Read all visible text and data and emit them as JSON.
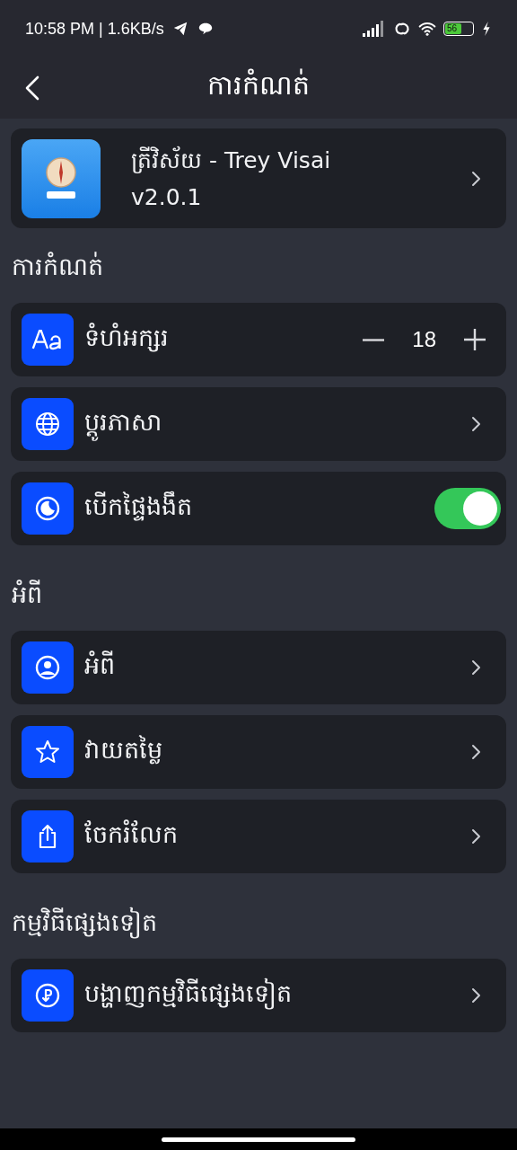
{
  "status_bar": {
    "time": "10:58 PM | 1.6KB/s",
    "battery": "56"
  },
  "header": {
    "title": "ការកំណត់"
  },
  "app_card": {
    "name": "ត្រីវិស័យ - Trey Visai",
    "version": "v2.0.1"
  },
  "sections": [
    {
      "heading": "ការកំណត់",
      "rows": [
        {
          "kind": "stepper",
          "label": "ទំហំអក្សរ",
          "value": "18"
        },
        {
          "kind": "link",
          "label": "ប្តូរភាសា"
        },
        {
          "kind": "toggle",
          "label": "បើកផ្ទៃងងឹត",
          "on": true
        }
      ]
    },
    {
      "heading": "អំពី",
      "rows": [
        {
          "kind": "link",
          "label": "អំពី"
        },
        {
          "kind": "link",
          "label": "វាយតម្លៃ"
        },
        {
          "kind": "link",
          "label": "ចែករំលែក"
        }
      ]
    },
    {
      "heading": "កម្មវិធីផ្សេងទៀត",
      "rows": [
        {
          "kind": "link",
          "label": "បង្ហាញកម្មវិធីផ្សេងទៀត"
        }
      ]
    }
  ]
}
